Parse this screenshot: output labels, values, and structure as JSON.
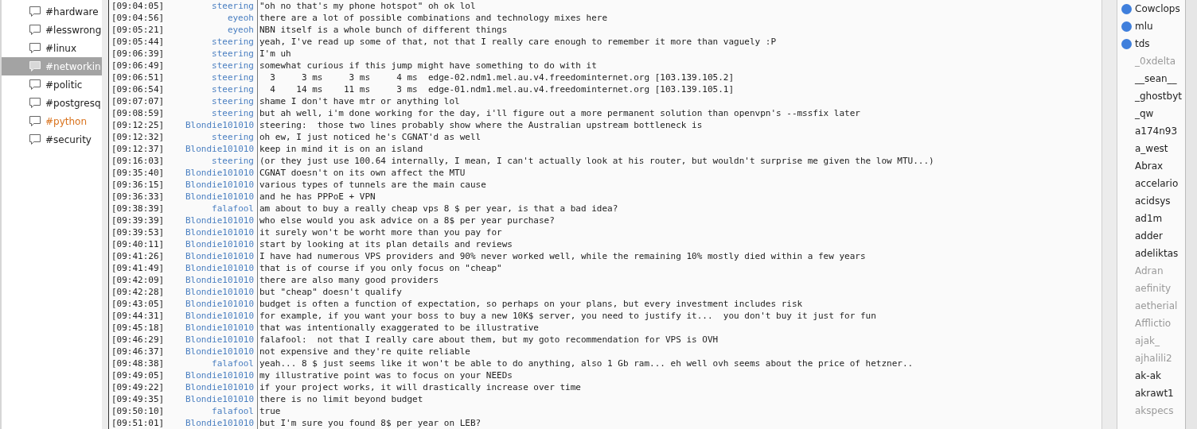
{
  "channels": [
    {
      "name": "#hardware",
      "selected": false,
      "highlighted": false
    },
    {
      "name": "#lesswrong",
      "selected": false,
      "highlighted": false
    },
    {
      "name": "#linux",
      "selected": false,
      "highlighted": false
    },
    {
      "name": "#networkin",
      "selected": true,
      "highlighted": false
    },
    {
      "name": "#politic",
      "selected": false,
      "highlighted": false
    },
    {
      "name": "#postgresq",
      "selected": false,
      "highlighted": false
    },
    {
      "name": "#python",
      "selected": false,
      "highlighted": true
    },
    {
      "name": "#security",
      "selected": false,
      "highlighted": false
    }
  ],
  "messages": [
    {
      "time": "[09:04:05]",
      "nick": "steering",
      "text": "\"oh no that's my phone hotspot\" oh ok lol"
    },
    {
      "time": "[09:04:56]",
      "nick": "eyeoh",
      "text": "there are a lot of possible combinations and technology mixes here"
    },
    {
      "time": "[09:05:21]",
      "nick": "eyeoh",
      "text": "NBN itself is a whole bunch of different things"
    },
    {
      "time": "[09:05:44]",
      "nick": "steering",
      "text": "yeah, I've read up some of that, not that I really care enough to remember it more than vaguely :P"
    },
    {
      "time": "[09:06:39]",
      "nick": "steering",
      "text": "I'm uh"
    },
    {
      "time": "[09:06:49]",
      "nick": "steering",
      "text": "somewhat curious if this jump might have something to do with it"
    },
    {
      "time": "[09:06:51]",
      "nick": "steering",
      "text": "  3     3 ms     3 ms     4 ms  edge-02.ndm1.mel.au.v4.freedominternet.org [103.139.105.2]"
    },
    {
      "time": "[09:06:54]",
      "nick": "steering",
      "text": "  4    14 ms    11 ms     3 ms  edge-01.ndm1.mel.au.v4.freedominternet.org [103.139.105.1]"
    },
    {
      "time": "[09:07:07]",
      "nick": "steering",
      "text": "shame I don't have mtr or anything lol"
    },
    {
      "time": "[09:08:59]",
      "nick": "steering",
      "text": "but ah well, i'm done working for the day, i'll figure out a more permanent solution than openvpn's --mssfix later"
    },
    {
      "time": "[09:12:25]",
      "nick": "Blondie101010",
      "text": "steering:  those two lines probably show where the Australian upstream bottleneck is"
    },
    {
      "time": "[09:12:32]",
      "nick": "steering",
      "text": "oh ew, I just noticed he's CGNAT'd as well"
    },
    {
      "time": "[09:12:37]",
      "nick": "Blondie101010",
      "text": "keep in mind it is on an island"
    },
    {
      "time": "[09:16:03]",
      "nick": "steering",
      "text": "(or they just use 100.64 internally, I mean, I can't actually look at his router, but wouldn't surprise me given the low MTU...)"
    },
    {
      "time": "[09:35:40]",
      "nick": "Blondie101010",
      "text": "CGNAT doesn't on its own affect the MTU"
    },
    {
      "time": "[09:36:15]",
      "nick": "Blondie101010",
      "text": "various types of tunnels are the main cause"
    },
    {
      "time": "[09:36:33]",
      "nick": "Blondie101010",
      "text": "and he has PPPoE + VPN"
    },
    {
      "time": "[09:38:39]",
      "nick": "falafool",
      "text": "am about to buy a really cheap vps 8 $ per year, is that a bad idea?"
    },
    {
      "time": "[09:39:39]",
      "nick": "Blondie101010",
      "text": "who else would you ask advice on a 8$ per year purchase?"
    },
    {
      "time": "[09:39:53]",
      "nick": "Blondie101010",
      "text": "it surely won't be worht more than you pay for"
    },
    {
      "time": "[09:40:11]",
      "nick": "Blondie101010",
      "text": "start by looking at its plan details and reviews"
    },
    {
      "time": "[09:41:26]",
      "nick": "Blondie101010",
      "text": "I have had numerous VPS providers and 90% never worked well, while the remaining 10% mostly died within a few years"
    },
    {
      "time": "[09:41:49]",
      "nick": "Blondie101010",
      "text": "that is of course if you only focus on \"cheap\""
    },
    {
      "time": "[09:42:09]",
      "nick": "Blondie101010",
      "text": "there are also many good providers"
    },
    {
      "time": "[09:42:28]",
      "nick": "Blondie101010",
      "text": "but \"cheap\" doesn't qualify"
    },
    {
      "time": "[09:43:05]",
      "nick": "Blondie101010",
      "text": "budget is often a function of expectation, so perhaps on your plans, but every investment includes risk"
    },
    {
      "time": "[09:44:31]",
      "nick": "Blondie101010",
      "text": "for example, if you want your boss to buy a new 10K$ server, you need to justify it...  you don't buy it just for fun"
    },
    {
      "time": "[09:45:18]",
      "nick": "Blondie101010",
      "text": "that was intentionally exaggerated to be illustrative"
    },
    {
      "time": "[09:46:29]",
      "nick": "Blondie101010",
      "text": "falafool:  not that I really care about them, but my goto recommendation for VPS is OVH"
    },
    {
      "time": "[09:46:37]",
      "nick": "Blondie101010",
      "text": "not expensive and they're quite reliable"
    },
    {
      "time": "[09:48:38]",
      "nick": "falafool",
      "text": "yeah... 8 $ just seems like it won't be able to do anything, also 1 Gb ram... eh well ovh seems about the price of hetzner.."
    },
    {
      "time": "[09:49:05]",
      "nick": "Blondie101010",
      "text": "my illustrative point was to focus on your NEEDs"
    },
    {
      "time": "[09:49:22]",
      "nick": "Blondie101010",
      "text": "if your project works, it will drastically increase over time"
    },
    {
      "time": "[09:49:35]",
      "nick": "Blondie101010",
      "text": "there is no limit beyond budget"
    },
    {
      "time": "[09:50:10]",
      "nick": "falafool",
      "text": "true"
    },
    {
      "time": "[09:51:01]",
      "nick": "Blondie101010",
      "text": "but I'm sure you found 8$ per year on LEB?"
    }
  ],
  "users": [
    {
      "name": "Cowclops",
      "opped": true,
      "away": false
    },
    {
      "name": "mlu",
      "opped": true,
      "away": false
    },
    {
      "name": "tds",
      "opped": true,
      "away": false
    },
    {
      "name": "_0xdelta",
      "opped": false,
      "away": true
    },
    {
      "name": "__sean__",
      "opped": false,
      "away": false
    },
    {
      "name": "_ghostbyt",
      "opped": false,
      "away": false
    },
    {
      "name": "_qw",
      "opped": false,
      "away": false
    },
    {
      "name": "a174n93",
      "opped": false,
      "away": false
    },
    {
      "name": "a_west",
      "opped": false,
      "away": false
    },
    {
      "name": "Abrax",
      "opped": false,
      "away": false
    },
    {
      "name": "accelario",
      "opped": false,
      "away": false
    },
    {
      "name": "acidsys",
      "opped": false,
      "away": false
    },
    {
      "name": "ad1m",
      "opped": false,
      "away": false
    },
    {
      "name": "adder",
      "opped": false,
      "away": false
    },
    {
      "name": "adeliktas",
      "opped": false,
      "away": false
    },
    {
      "name": "Adran",
      "opped": false,
      "away": true
    },
    {
      "name": "aefinity",
      "opped": false,
      "away": true
    },
    {
      "name": "aetherial",
      "opped": false,
      "away": true
    },
    {
      "name": "Afflictio",
      "opped": false,
      "away": true
    },
    {
      "name": "ajak_",
      "opped": false,
      "away": true
    },
    {
      "name": "ajhalili2",
      "opped": false,
      "away": true
    },
    {
      "name": "ak-ak",
      "opped": false,
      "away": false
    },
    {
      "name": "akrawt1",
      "opped": false,
      "away": false
    },
    {
      "name": "akspecs",
      "opped": false,
      "away": true
    }
  ]
}
